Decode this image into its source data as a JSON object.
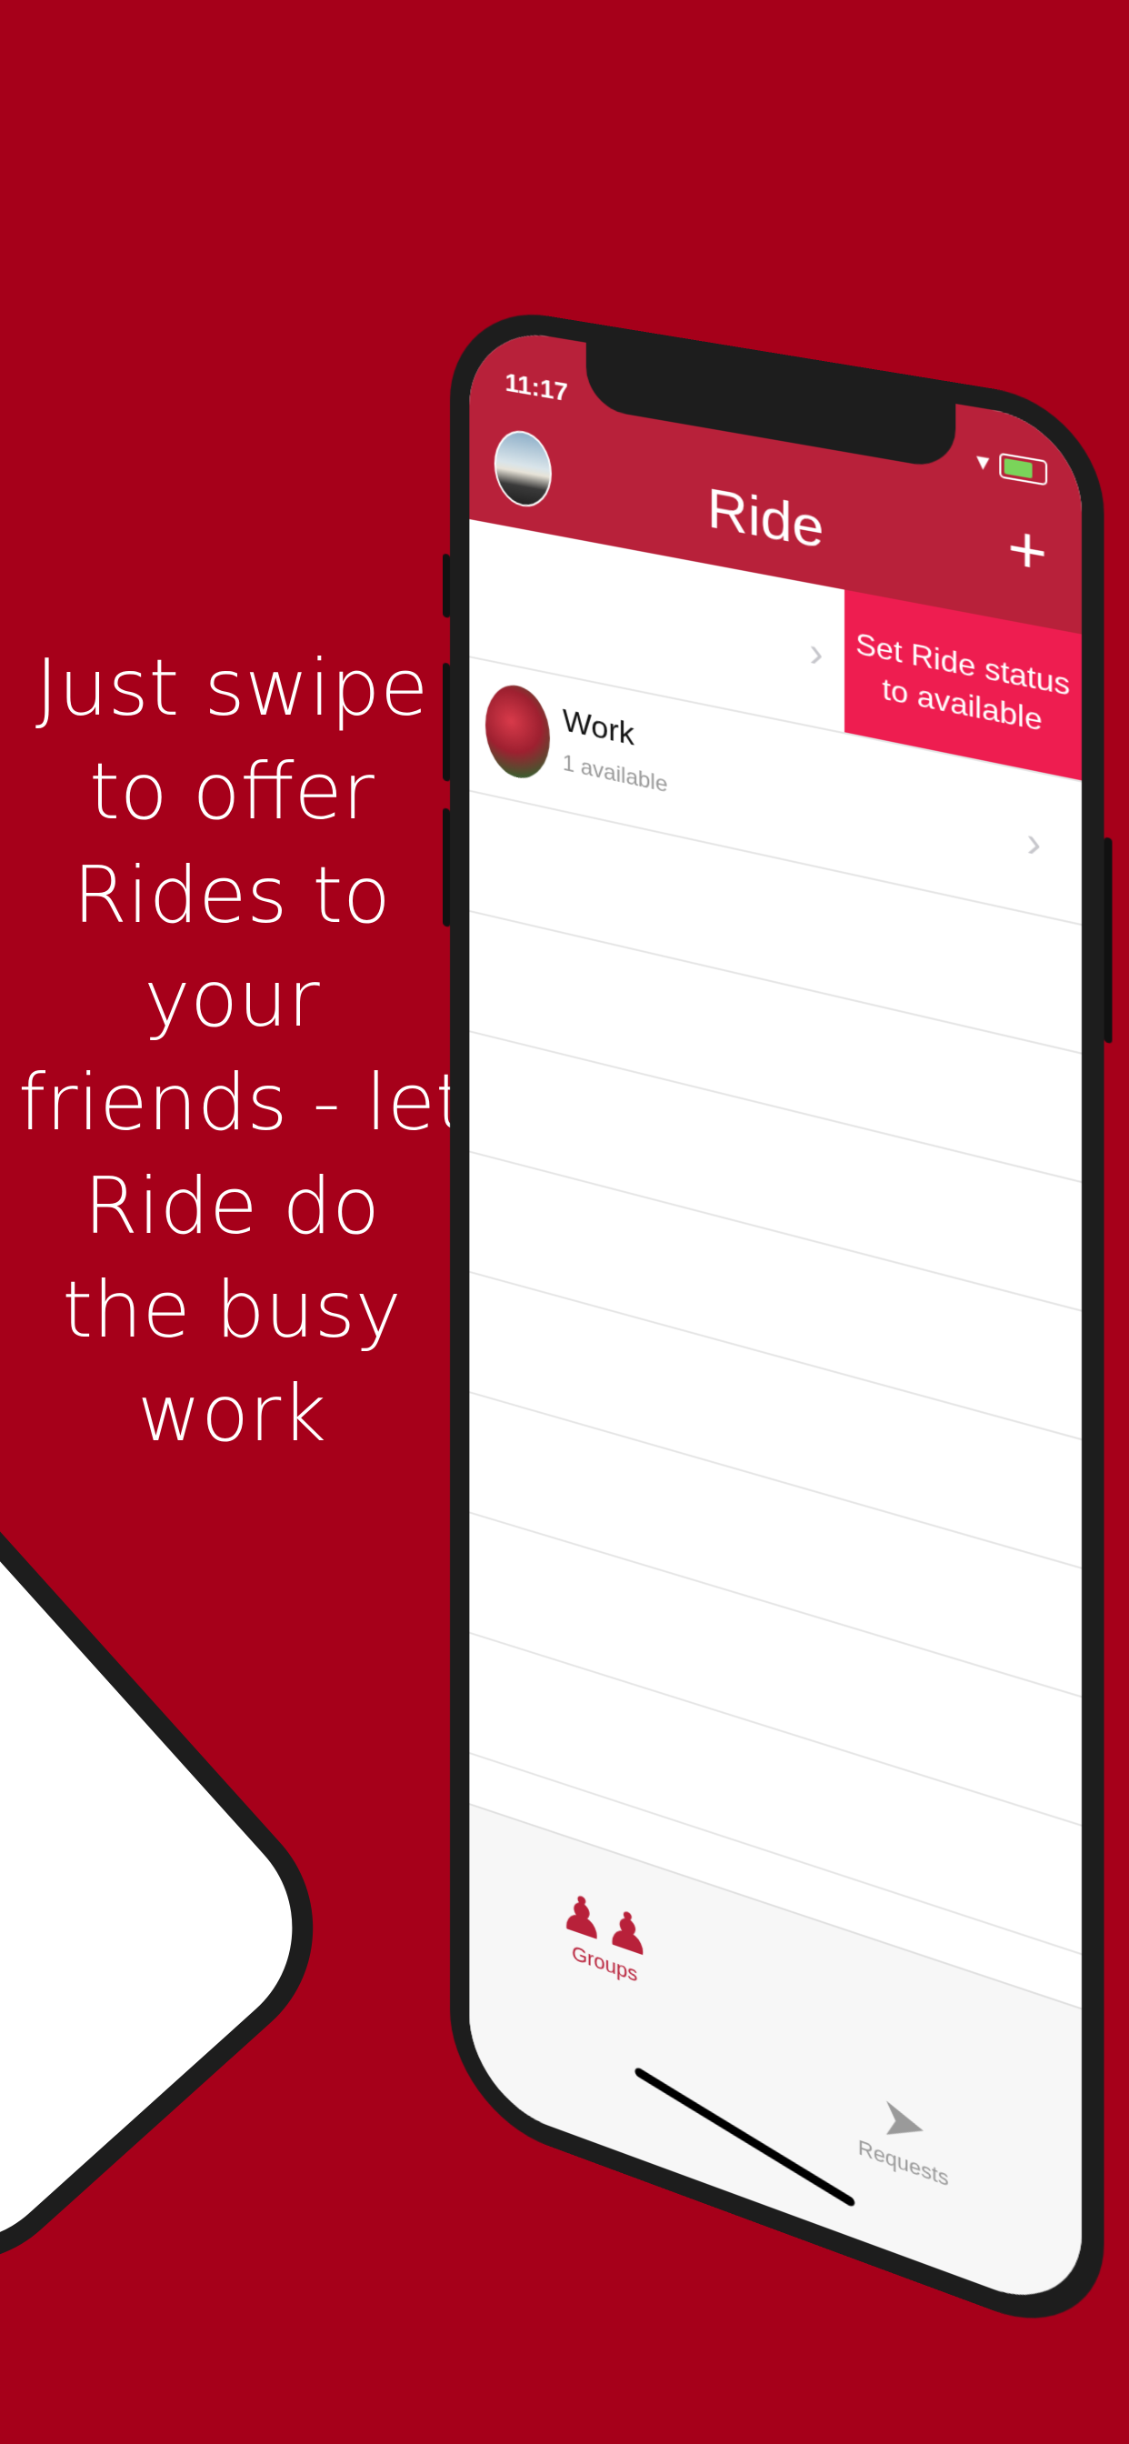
{
  "headline": {
    "lines": [
      "Just swipe",
      "to offer",
      "Rides to",
      "your",
      "friends - let",
      "Ride do",
      "the busy",
      "work"
    ]
  },
  "secondary_phone": {
    "link_fragment": "and"
  },
  "status_bar": {
    "time": "11:17"
  },
  "navbar": {
    "title": "Ride",
    "add_label": "+"
  },
  "list": {
    "swiped_row": {
      "action_label": "Set Ride status to available"
    },
    "groups": [
      {
        "name": "Work",
        "subtitle": "1 available"
      }
    ]
  },
  "tabbar": {
    "tabs": [
      {
        "label": "Groups",
        "icon": "two-people-icon",
        "active": true
      },
      {
        "label": "Requests",
        "icon": "paper-plane-icon",
        "active": false
      }
    ]
  },
  "colors": {
    "background": "#a6001a",
    "navbar": "#b8213a",
    "swipe_action": "#ee1d50",
    "tab_active": "#b8213a"
  }
}
